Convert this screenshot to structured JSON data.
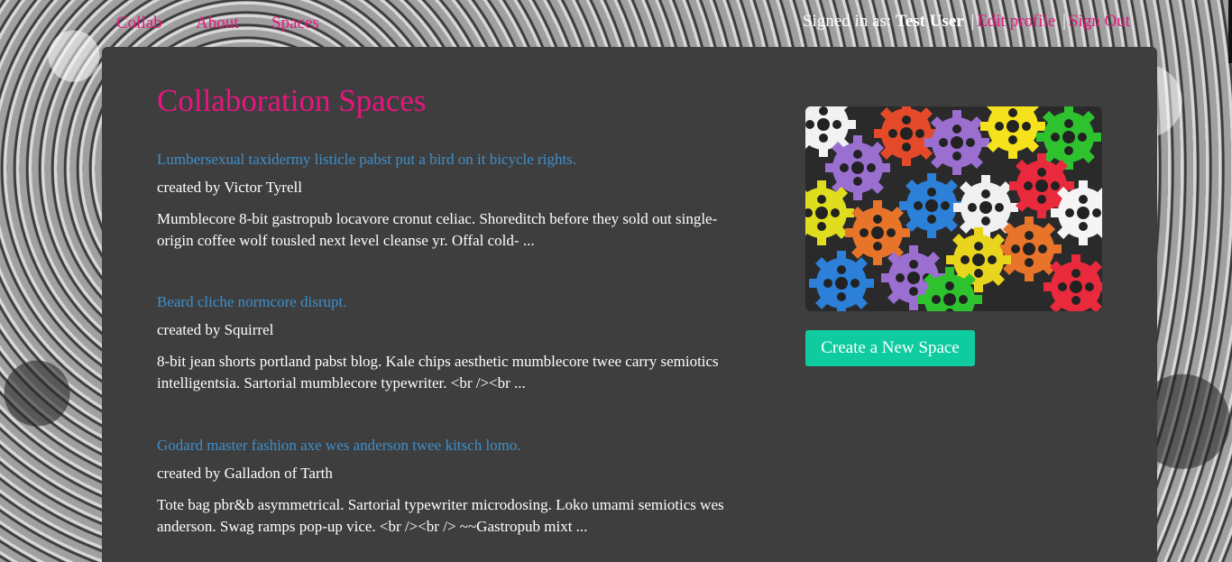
{
  "nav": {
    "items": [
      {
        "label": "Collab"
      },
      {
        "label": "About"
      },
      {
        "label": "Spaces"
      }
    ],
    "signed_in_prefix": "Signed in as:",
    "user_name": "Test User",
    "separator": "|",
    "edit_profile": "Edit profile",
    "sign_out": "Sign Out"
  },
  "main": {
    "title": "Collaboration Spaces",
    "spaces": [
      {
        "title": "Lumbersexual taxidermy listicle pabst put a bird on it bicycle rights.",
        "author": "created by Victor Tyrell",
        "description": "Mumblecore 8-bit gastropub locavore cronut celiac. Shoreditch before they sold out single-origin coffee wolf tousled next level cleanse yr. Offal cold- ..."
      },
      {
        "title": "Beard cliche normcore disrupt.",
        "author": "created by Squirrel",
        "description": "8-bit jean shorts portland pabst blog. Kale chips aesthetic mumblecore twee carry semiotics intelligentsia. Sartorial mumblecore typewriter. <br /><br ..."
      },
      {
        "title": "Godard master fashion axe wes anderson twee kitsch lomo.",
        "author": "created by Galladon of Tarth",
        "description": "Tote bag pbr&b asymmetrical. Sartorial typewriter microdosing. Loko umami semiotics wes anderson. Swag ramps pop-up vice. <br /><br /> ~~Gastropub mixt ..."
      }
    ]
  },
  "sidebar": {
    "image_icon": "colorful-gears-image",
    "create_button": "Create a New Space"
  },
  "colors": {
    "accent": "#e8157e",
    "link": "#3f8fc8",
    "panel": "#3e3e3f",
    "button": "#0fcca0"
  }
}
